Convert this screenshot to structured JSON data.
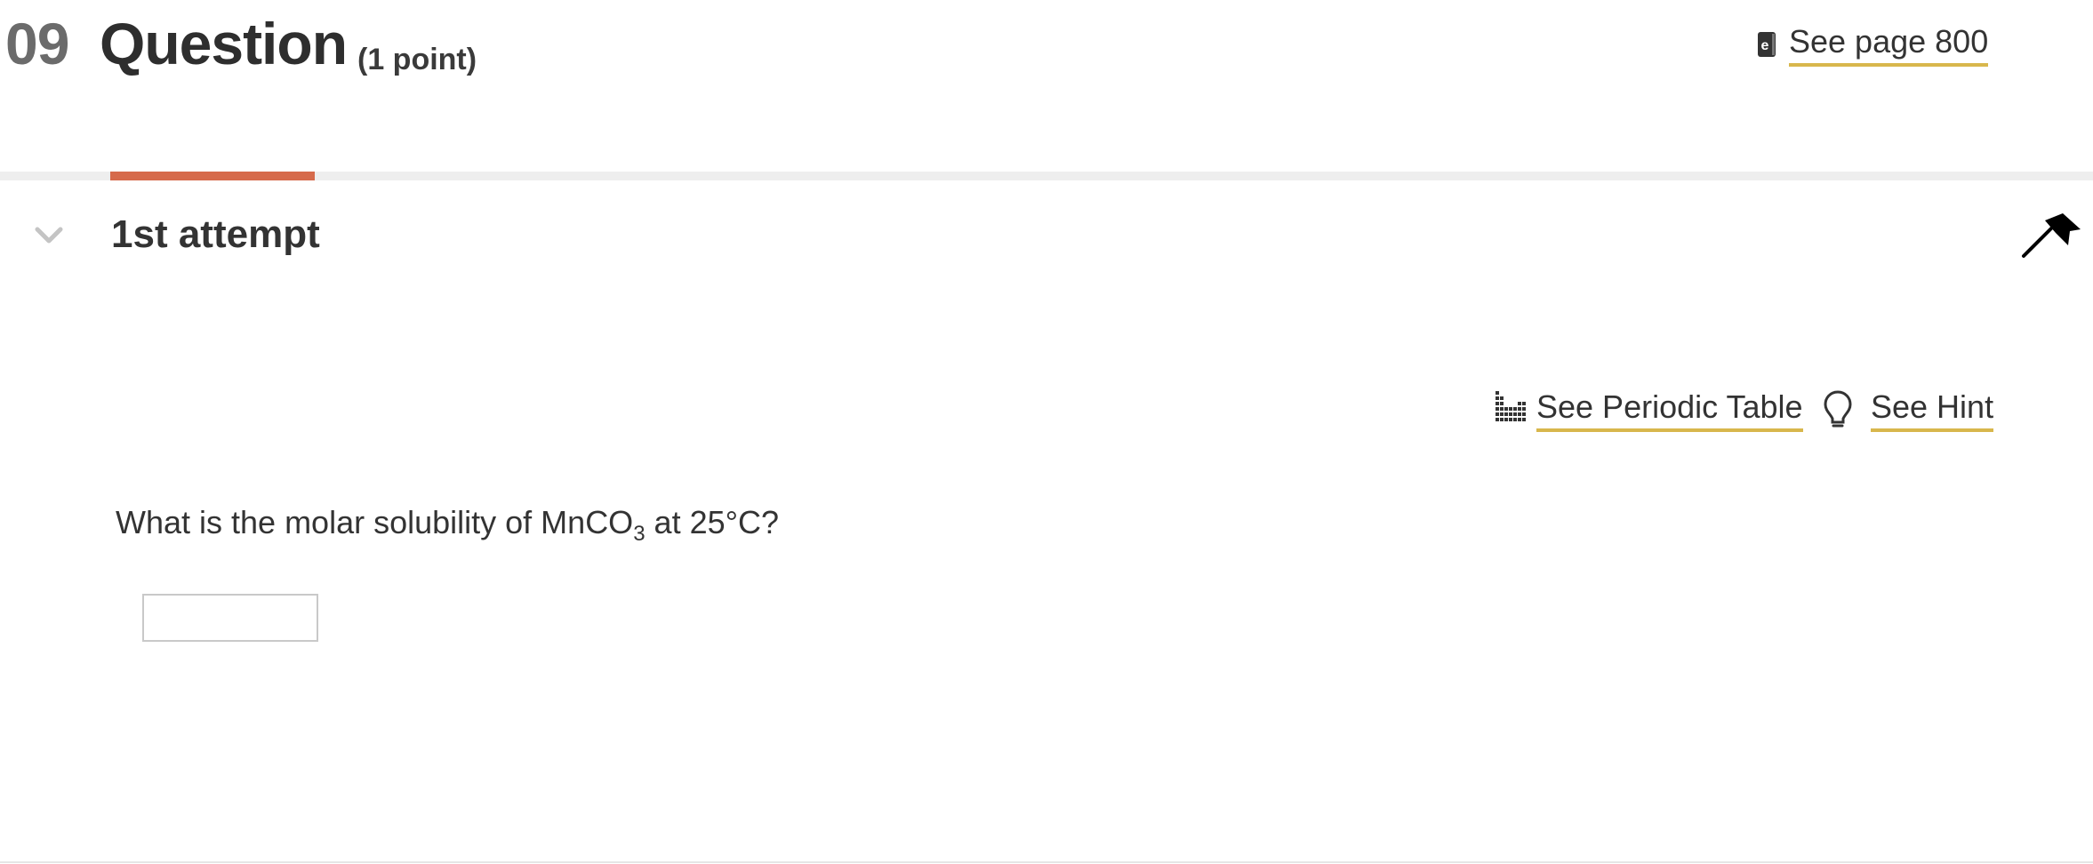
{
  "header": {
    "question_number": "09",
    "title": "Question",
    "points": "(1 point)",
    "ebook_link": "See page 800"
  },
  "attempt": {
    "label": "1st attempt",
    "progress_fraction": 0.098
  },
  "tools": {
    "periodic_table": "See Periodic Table",
    "hint": "See Hint"
  },
  "question": {
    "text_before": "What is the molar solubility of MnCO",
    "subscript": "3",
    "text_after": " at 25°C?"
  },
  "answer": {
    "value": "",
    "placeholder": ""
  },
  "colors": {
    "accent_progress": "#d66a4b",
    "link_underline": "#d8b74c",
    "text": "#333333"
  },
  "icons": [
    "ebook-icon",
    "chevron-down-icon",
    "flag-icon",
    "periodic-table-icon",
    "lightbulb-icon"
  ]
}
